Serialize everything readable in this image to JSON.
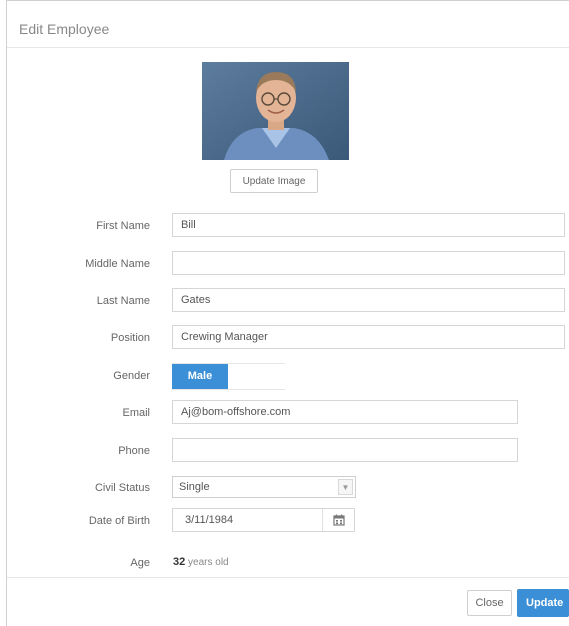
{
  "modal": {
    "title": "Edit Employee",
    "update_image_label": "Update Image"
  },
  "form": {
    "first_name": {
      "label": "First Name",
      "value": "Bill"
    },
    "middle_name": {
      "label": "Middle Name",
      "value": ""
    },
    "last_name": {
      "label": "Last Name",
      "value": "Gates"
    },
    "position": {
      "label": "Position",
      "value": "Crewing Manager"
    },
    "gender": {
      "label": "Gender",
      "selected": "Male"
    },
    "email": {
      "label": "Email",
      "value": "Aj@bom-offshore.com"
    },
    "phone": {
      "label": "Phone",
      "value": ""
    },
    "civil_status": {
      "label": "Civil Status",
      "selected": "Single"
    },
    "date_of_birth": {
      "label": "Date of Birth",
      "value": "3/11/1984"
    },
    "age": {
      "label": "Age",
      "value": "32",
      "suffix": "years old"
    }
  },
  "footer": {
    "close_label": "Close",
    "update_label": "Update"
  },
  "colors": {
    "accent": "#3b8fd6"
  },
  "icons": {
    "calendar": "calendar-icon",
    "dropdown": "chevron-down-icon"
  }
}
